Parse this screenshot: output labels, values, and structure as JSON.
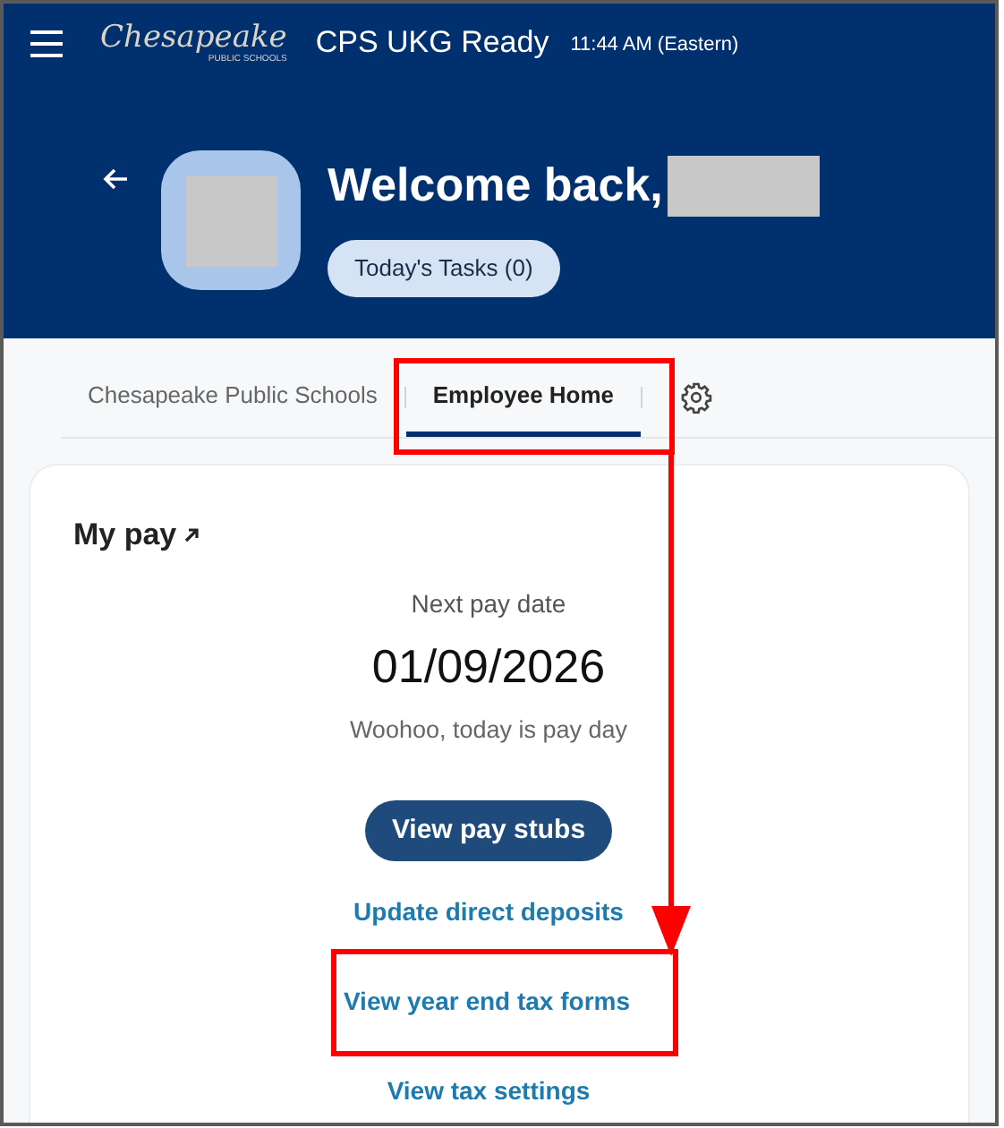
{
  "header": {
    "logo": {
      "script": "Chesapeake",
      "subtitle": "PUBLIC SCHOOLS"
    },
    "app_title": "CPS UKG Ready",
    "time": "11:44 AM (Eastern)"
  },
  "welcome": {
    "greeting": "Welcome back,",
    "tasks_button": "Today's Tasks (0)"
  },
  "tabs": [
    {
      "label": "Chesapeake Public Schools",
      "selected": false
    },
    {
      "label": "Employee Home",
      "selected": true
    }
  ],
  "my_pay": {
    "title": "My pay",
    "next_pay_label": "Next pay date",
    "next_pay_date": "01/09/2026",
    "message": "Woohoo, today is pay day",
    "primary_button": "View pay stubs",
    "links": [
      {
        "label": "Update direct deposits",
        "highlighted": false
      },
      {
        "label": "View year end tax forms",
        "highlighted": true
      },
      {
        "label": "View tax settings",
        "highlighted": false
      }
    ]
  }
}
